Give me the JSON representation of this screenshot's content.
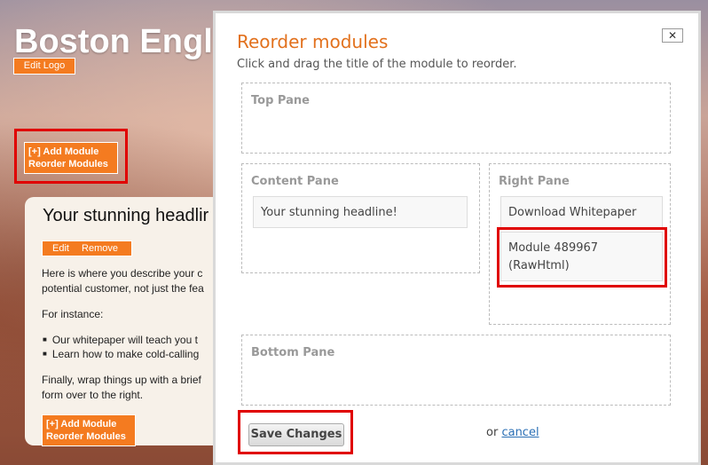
{
  "site": {
    "title": "Boston Engl",
    "edit_logo": "Edit Logo",
    "module_menu_top": {
      "add": "[+] Add Module",
      "reorder": "Reorder Modules"
    },
    "module_menu_bottom": {
      "add": "[+] Add Module",
      "reorder": "Reorder Modules"
    }
  },
  "content": {
    "headline": "Your stunning headlir",
    "edit": "Edit",
    "remove": "Remove",
    "para1_line1": "Here is where you describe your c",
    "para1_line2": "potential customer, not just the fea",
    "for_instance": "For instance:",
    "bullets": [
      "Our whitepaper will teach you t",
      "Learn how to make cold-calling"
    ],
    "final_line1": "Finally, wrap things up with a brief",
    "final_line2": "form over to the right."
  },
  "modal": {
    "title": "Reorder modules",
    "subtitle": "Click and drag the title of the module to reorder.",
    "close": "✕",
    "panes": {
      "top": "Top Pane",
      "content": "Content Pane",
      "right": "Right Pane",
      "bottom": "Bottom Pane"
    },
    "content_modules": [
      "Your stunning headline!"
    ],
    "right_modules": [
      "Download Whitepaper",
      "Module 489967 (RawHtml)"
    ],
    "save": "Save Changes",
    "or": "or",
    "cancel": "cancel"
  },
  "colors": {
    "accent": "#f47b20",
    "highlight": "#e00000",
    "link": "#2a6fb5"
  }
}
